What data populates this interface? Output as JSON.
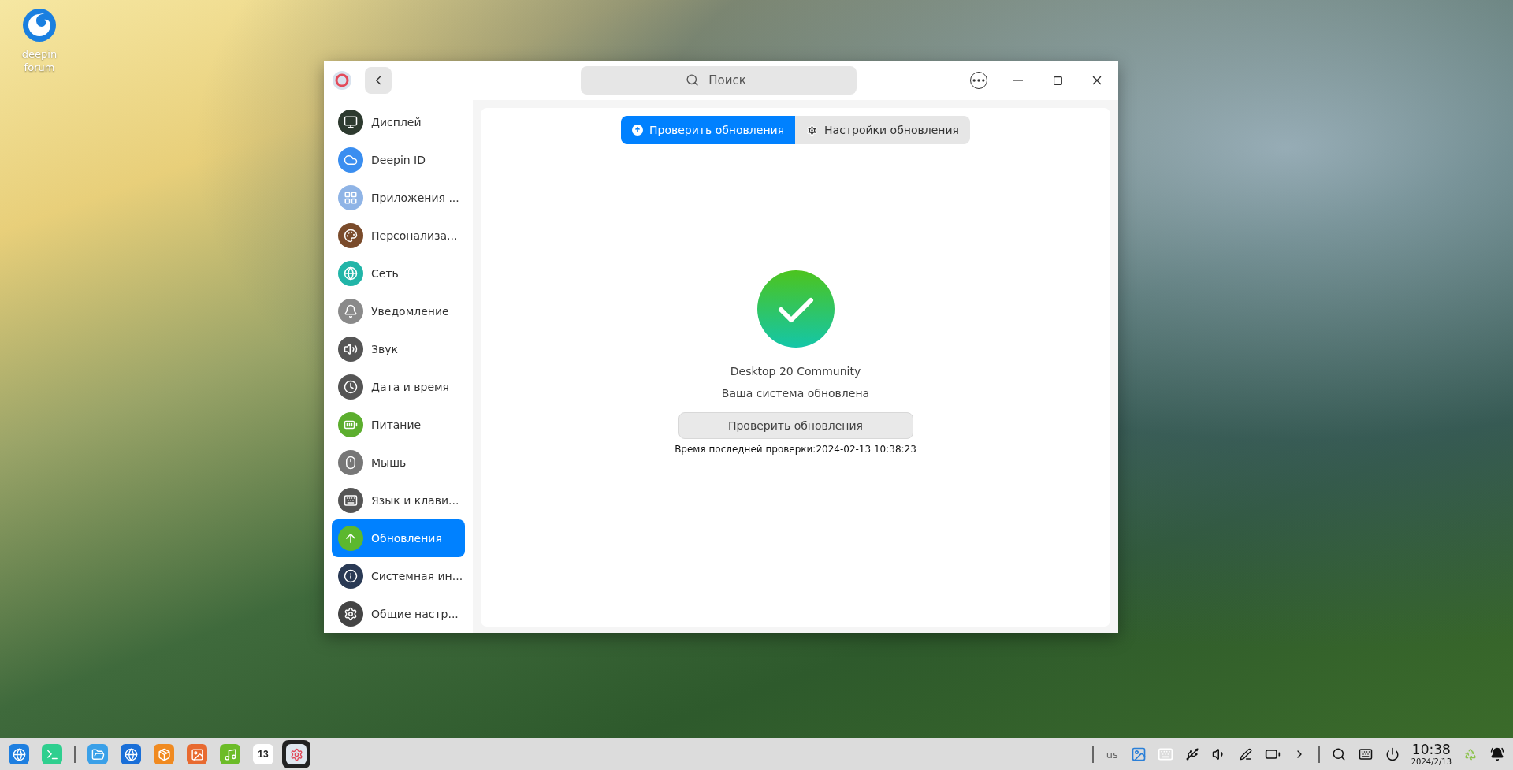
{
  "desktop_icons": [
    {
      "label": "deepin forum"
    }
  ],
  "window": {
    "search": {
      "placeholder": "Поиск"
    },
    "sidebar": {
      "items": [
        {
          "label": "Дисплей",
          "selected": false
        },
        {
          "label": "Deepin ID",
          "selected": false
        },
        {
          "label": "Приложения ...",
          "selected": false
        },
        {
          "label": "Персонализа...",
          "selected": false
        },
        {
          "label": "Сеть",
          "selected": false
        },
        {
          "label": "Уведомление",
          "selected": false
        },
        {
          "label": "Звук",
          "selected": false
        },
        {
          "label": "Дата и время",
          "selected": false
        },
        {
          "label": "Питание",
          "selected": false
        },
        {
          "label": "Мышь",
          "selected": false
        },
        {
          "label": "Язык и клави...",
          "selected": false
        },
        {
          "label": "Обновления",
          "selected": true
        },
        {
          "label": "Системная ин...",
          "selected": false
        },
        {
          "label": "Общие настр...",
          "selected": false
        }
      ]
    },
    "tabs": [
      {
        "label": "Проверить обновления",
        "selected": true
      },
      {
        "label": "Настройки обновления",
        "selected": false
      }
    ],
    "status": {
      "version": "Desktop 20 Community",
      "message": "Ваша система обновлена",
      "button": "Проверить обновления",
      "last_check": "Время последней проверки:2024-02-13 10:38:23"
    }
  },
  "taskbar": {
    "apps": [
      {
        "selected": false
      },
      {
        "selected": false
      },
      {
        "selected": false
      },
      {
        "selected": false
      },
      {
        "selected": false
      },
      {
        "selected": false
      },
      {
        "selected": false
      },
      {
        "selected": false,
        "day": "13"
      },
      {
        "selected": true
      }
    ],
    "layout": "us",
    "time": "10:38",
    "date": "2024/2/13"
  }
}
